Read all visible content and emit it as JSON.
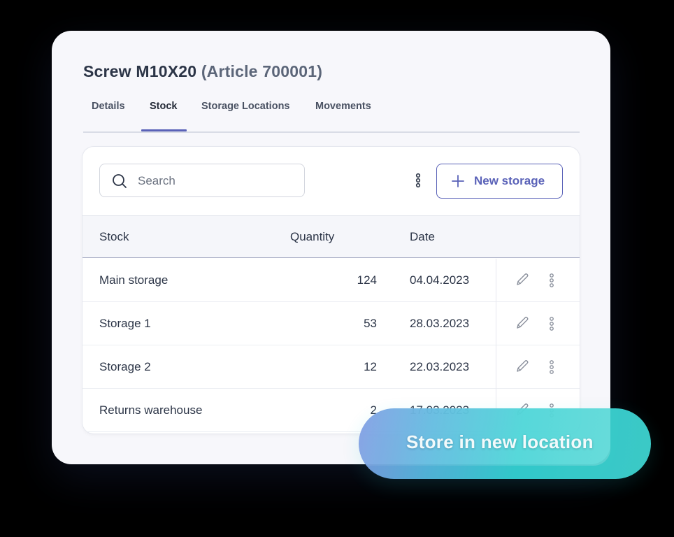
{
  "header": {
    "title": "Screw M10X20",
    "subtitle": "(Article 700001)"
  },
  "tabs": [
    {
      "label": "Details",
      "active": false
    },
    {
      "label": "Stock",
      "active": true
    },
    {
      "label": "Storage Locations",
      "active": false
    },
    {
      "label": "Movements",
      "active": false
    }
  ],
  "toolbar": {
    "search_placeholder": "Search",
    "search_value": "",
    "new_button_label": "New storage",
    "more_icon": "kebab-vertical-icon"
  },
  "table": {
    "columns": [
      "Stock",
      "Quantity",
      "Date"
    ],
    "rows": [
      {
        "stock": "Main storage",
        "quantity": "124",
        "date": "04.04.2023"
      },
      {
        "stock": "Storage 1",
        "quantity": "53",
        "date": "28.03.2023"
      },
      {
        "stock": "Storage 2",
        "quantity": "12",
        "date": "22.03.2023"
      },
      {
        "stock": "Returns warehouse",
        "quantity": "2",
        "date": "17.03.2023"
      }
    ],
    "row_actions": [
      "edit-pencil-icon",
      "kebab-vertical-icon"
    ]
  },
  "cta": {
    "label": "Store in new location"
  },
  "colors": {
    "accent": "#5a62b8",
    "text": "#2c3547",
    "cta_gradient_start": "#7f9be3",
    "cta_gradient_end": "#3fd2cf"
  }
}
